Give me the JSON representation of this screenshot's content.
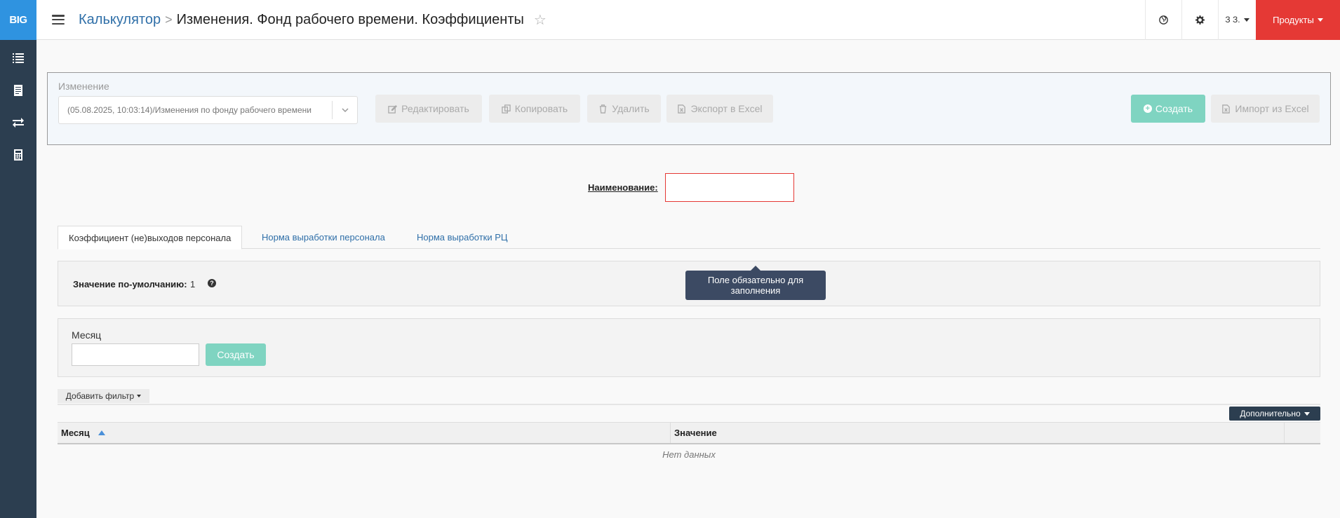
{
  "app": {
    "logo_text": "BIG"
  },
  "sidebar": {
    "items": [
      {
        "icon": "list-icon"
      },
      {
        "icon": "document-icon"
      },
      {
        "icon": "exchange-icon"
      },
      {
        "icon": "calculator-icon"
      }
    ]
  },
  "header": {
    "breadcrumb_parent": "Калькулятор",
    "breadcrumb_separator": ">",
    "title": "Изменения. Фонд рабочего времени. Коэффициенты",
    "user_label": "З З.",
    "products_label": "Продукты"
  },
  "change_panel": {
    "label": "Изменение",
    "selected_value": "(05.08.2025, 10:03:14)/Изменения по фонду рабочего времени",
    "edit_label": "Редактировать",
    "copy_label": "Копировать",
    "delete_label": "Удалить",
    "export_label": "Экспорт в Excel",
    "create_label": "Создать",
    "import_label": "Импорт из Excel"
  },
  "name_field": {
    "label": "Наименование:",
    "value": ""
  },
  "tabs": [
    {
      "label": "Коэффициент (не)выходов персонала",
      "active": true
    },
    {
      "label": "Норма выработки персонала",
      "active": false
    },
    {
      "label": "Норма выработки РЦ",
      "active": false
    }
  ],
  "default_value": {
    "label": "Значение по-умолчанию:",
    "value": "1",
    "help": "?"
  },
  "tooltip": {
    "text": "Поле обязательно для заполнения"
  },
  "month_panel": {
    "label": "Месяц",
    "value": "",
    "create_label": "Создать"
  },
  "filter": {
    "add_label": "Добавить фильтр"
  },
  "more": {
    "label": "Дополнительно"
  },
  "table": {
    "columns": [
      "Месяц",
      "Значение"
    ],
    "empty_text": "Нет данных"
  },
  "colors": {
    "sidebar_bg": "#2c3e50",
    "logo_bg": "#2f93e0",
    "products_bg": "#e53935",
    "create_btn": "#7fd4c1",
    "link": "#2f6fa8",
    "tooltip_bg": "#3c4a63"
  }
}
